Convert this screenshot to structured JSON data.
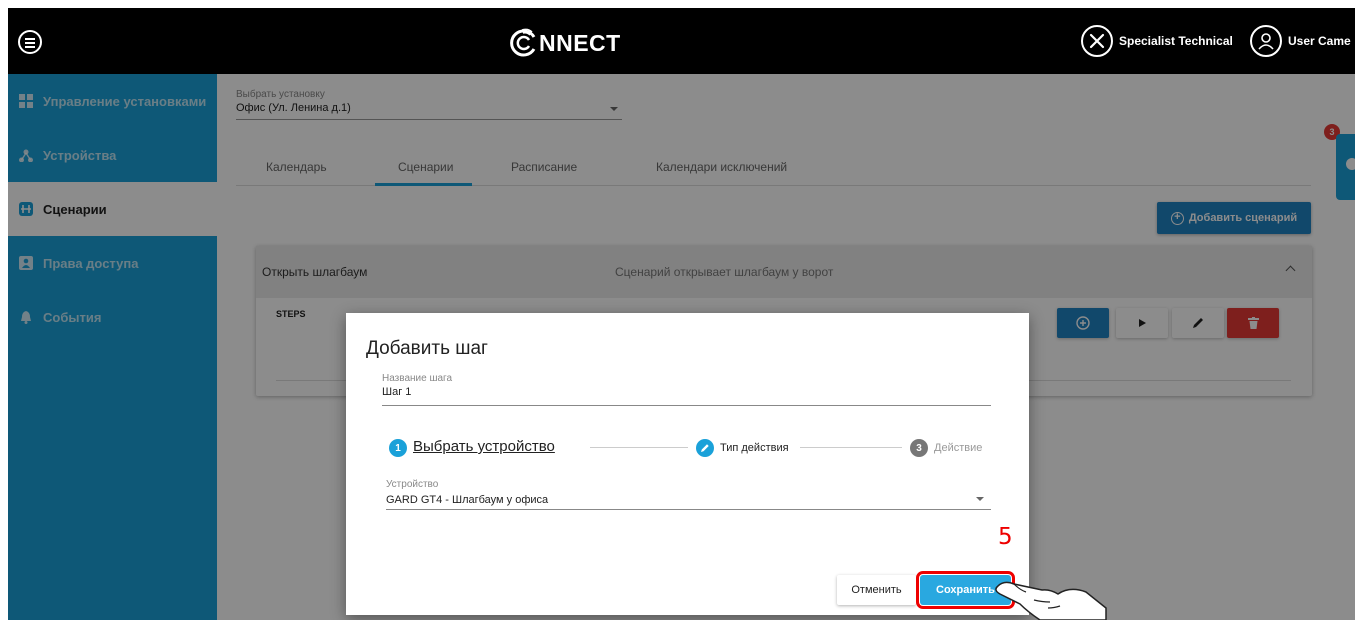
{
  "header": {
    "logo_text": "NNECT",
    "specialist": "Specialist Technical",
    "user": "User Came"
  },
  "sidebar": {
    "items": [
      {
        "label": "Управление установками",
        "icon": "grid-icon"
      },
      {
        "label": "Устройства",
        "icon": "devices-icon"
      },
      {
        "label": "Сценарии",
        "icon": "scenarios-icon",
        "active": true
      },
      {
        "label": "Права доступа",
        "icon": "badge-icon"
      },
      {
        "label": "События",
        "icon": "bell-icon"
      }
    ]
  },
  "installation": {
    "label": "Выбрать установку",
    "value": "Офис (Ул. Ленина д.1)"
  },
  "tabs": [
    "Календарь",
    "Сценарии",
    "Расписание",
    "Календари исключений"
  ],
  "active_tab": "Сценарии",
  "notification_count": "3",
  "add_scenario_label": "Добавить сценарий",
  "scenario": {
    "title": "Открыть шлагбаум",
    "description": "Сценарий открывает шлагбаум у ворот",
    "steps_label": "STEPS"
  },
  "modal": {
    "title": "Добавить шаг",
    "step_name_label": "Название шага",
    "step_name_value": "Шаг 1",
    "stepper": [
      {
        "num": "1",
        "label": "Выбрать устройство",
        "state": "active"
      },
      {
        "num": "",
        "label": "Тип действия",
        "state": "editing"
      },
      {
        "num": "3",
        "label": "Действие",
        "state": "pending"
      }
    ],
    "device_label": "Устройство",
    "device_value": "GARD GT4 - Шлагбаум у офиса",
    "cancel_label": "Отменить",
    "save_label": "Сохранить"
  },
  "annotation_number": "5",
  "colors": {
    "accent": "#1aa1d9",
    "primary_button": "#1f83c4",
    "save_button": "#29a8e0",
    "danger": "#e53935",
    "highlight": "#e00000"
  }
}
